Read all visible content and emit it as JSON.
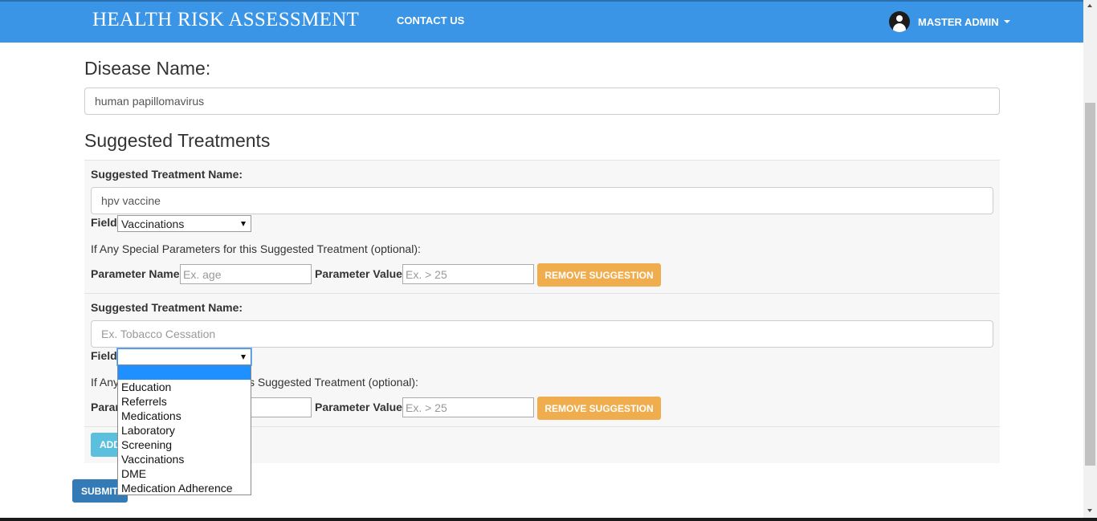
{
  "header": {
    "brand": "HEALTH RISK ASSESSMENT",
    "nav_contact": "CONTACT US",
    "user_name": "MASTER ADMIN",
    "bg_color": "#3a95e6"
  },
  "disease": {
    "heading": "Disease Name:",
    "value": "human papillomavirus"
  },
  "treatments": {
    "heading": "Suggested Treatments",
    "items": [
      {
        "name_label": "Suggested Treatment Name:",
        "name_value": "hpv vaccine",
        "field_label": "Field",
        "field_value": "Vaccinations",
        "params_hint": "If Any Special Parameters for this Suggested Treatment (optional):",
        "param_name_label": "Parameter Name:",
        "param_name_placeholder": "Ex. age",
        "param_value_label": "Parameter Value:",
        "param_value_placeholder": "Ex. > 25",
        "remove_label": "REMOVE SUGGESTION"
      },
      {
        "name_label": "Suggested Treatment Name:",
        "name_placeholder": "Ex. Tobacco Cessation",
        "field_label": "Field",
        "field_value": "",
        "params_hint_visible": "If Any",
        "params_hint_tail": "s Suggested Treatment (optional):",
        "param_name_label_visible": "Paran",
        "param_value_label": "Parameter Value:",
        "param_value_placeholder": "Ex. > 25",
        "remove_label": "REMOVE SUGGESTION"
      }
    ],
    "add_label_visible": "ADD",
    "submit_label_visible": "SUBMIT"
  },
  "field_dropdown": {
    "options": [
      "",
      "Education",
      "Referrels",
      "Medications",
      "Laboratory",
      "Screening",
      "Vaccinations",
      "DME",
      "Medication Adherence"
    ],
    "highlighted_index": 0
  },
  "colors": {
    "warning": "#f0ad4e",
    "info": "#5bc0de",
    "primary": "#337ab7",
    "highlight": "#1e90ff"
  }
}
